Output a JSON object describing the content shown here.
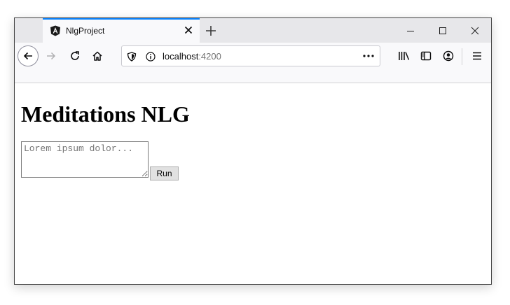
{
  "browser": {
    "tab": {
      "title": "NlgProject",
      "favicon": "angular-logo-icon",
      "close_icon": "close-icon"
    },
    "new_tab_icon": "plus-icon",
    "window_controls": [
      "minimize-icon",
      "maximize-icon",
      "close-window-icon"
    ],
    "toolbar": {
      "back_icon": "back-arrow-icon",
      "forward_icon": "forward-arrow-icon",
      "reload_icon": "reload-icon",
      "home_icon": "home-icon",
      "library_icon": "library-icon",
      "sidebar_icon": "sidebar-icon",
      "account_icon": "account-icon",
      "menu_icon": "hamburger-menu-icon"
    },
    "address_bar": {
      "host": "localhost",
      "port": ":4200",
      "more_label": "•••"
    }
  },
  "page": {
    "heading": "Meditations NLG",
    "input": {
      "placeholder": "Lorem ipsum dolor..."
    },
    "run_label": "Run"
  }
}
